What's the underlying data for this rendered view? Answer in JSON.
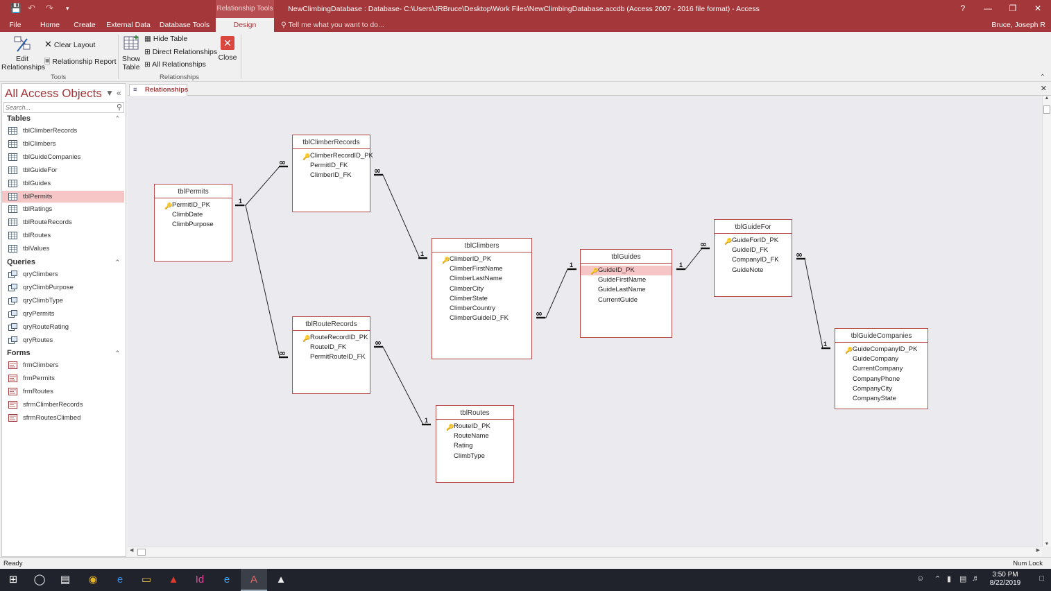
{
  "titlebar": {
    "title": "NewClimbingDatabase : Database- C:\\Users\\JRBruce\\Desktop\\Work Files\\NewClimbingDatabase.accdb (Access 2007 - 2016 file format) - Access",
    "context_tab": "Relationship Tools",
    "help": "?",
    "minimize": "—",
    "restore": "❐",
    "close": "✕"
  },
  "tabs": [
    {
      "label": "File"
    },
    {
      "label": "Home"
    },
    {
      "label": "Create"
    },
    {
      "label": "External Data"
    },
    {
      "label": "Database Tools"
    },
    {
      "label": "Design"
    }
  ],
  "tellme": "Tell me what you want to do...",
  "user": "Bruce, Joseph R",
  "ribbon": {
    "edit_relationships": "Edit Relationships",
    "clear_layout": "Clear Layout",
    "relationship_report": "Relationship Report",
    "show_table": "Show Table",
    "hide_table": "Hide Table",
    "direct_relationships": "Direct Relationships",
    "all_relationships": "All Relationships",
    "close": "Close",
    "group_tools": "Tools",
    "group_relationships": "Relationships"
  },
  "nav": {
    "title": "All Access Objects",
    "search_placeholder": "Search...",
    "sections": [
      {
        "label": "Tables"
      },
      {
        "label": "Queries"
      },
      {
        "label": "Forms"
      }
    ],
    "tables": [
      "tblClimberRecords",
      "tblClimbers",
      "tblGuideCompanies",
      "tblGuideFor",
      "tblGuides",
      "tblPermits",
      "tblRatings",
      "tblRouteRecords",
      "tblRoutes",
      "tblValues"
    ],
    "queries": [
      "qryClimbers",
      "qryClimbPurpose",
      "qryClimbType",
      "qryPermits",
      "qryRouteRating",
      "qryRoutes"
    ],
    "forms": [
      "frmClimbers",
      "frmPermits",
      "frmRoutes",
      "sfrmClimberRecords",
      "sfrmRoutesClimbed"
    ],
    "selected": "tblPermits"
  },
  "doc_tab": "Relationships",
  "tables": [
    {
      "name": "tblPermits",
      "fields": [
        {
          "name": "PermitID_PK",
          "key": true
        },
        {
          "name": "ClimbDate"
        },
        {
          "name": "ClimbPurpose"
        }
      ]
    },
    {
      "name": "tblClimberRecords",
      "fields": [
        {
          "name": "ClimberRecordID_PK",
          "key": true
        },
        {
          "name": "PermitID_FK"
        },
        {
          "name": "ClimberID_FK"
        }
      ]
    },
    {
      "name": "tblRouteRecords",
      "fields": [
        {
          "name": "RouteRecordID_PK",
          "key": true
        },
        {
          "name": "RouteID_FK"
        },
        {
          "name": "PermitRouteID_FK"
        }
      ]
    },
    {
      "name": "tblClimbers",
      "fields": [
        {
          "name": "ClimberID_PK",
          "key": true
        },
        {
          "name": "ClimberFirstName"
        },
        {
          "name": "ClimberLastName"
        },
        {
          "name": "ClimberCity"
        },
        {
          "name": "ClimberState"
        },
        {
          "name": "ClimberCountry"
        },
        {
          "name": "ClimberGuideID_FK"
        }
      ]
    },
    {
      "name": "tblRoutes",
      "fields": [
        {
          "name": "RouteID_PK",
          "key": true
        },
        {
          "name": "RouteName"
        },
        {
          "name": "Rating"
        },
        {
          "name": "ClimbType"
        }
      ]
    },
    {
      "name": "tblGuides",
      "fields": [
        {
          "name": "GuideID_PK",
          "key": true,
          "selected": true
        },
        {
          "name": "GuideFirstName"
        },
        {
          "name": "GuideLastName"
        },
        {
          "name": "CurrentGuide"
        }
      ]
    },
    {
      "name": "tblGuideFor",
      "fields": [
        {
          "name": "GuideForID_PK",
          "key": true
        },
        {
          "name": "GuideID_FK"
        },
        {
          "name": "CompanyID_FK"
        },
        {
          "name": "GuideNote"
        }
      ]
    },
    {
      "name": "tblGuideCompanies",
      "fields": [
        {
          "name": "GuideCompanyID_PK",
          "key": true
        },
        {
          "name": "GuideCompany"
        },
        {
          "name": "CurrentCompany"
        },
        {
          "name": "CompanyPhone"
        },
        {
          "name": "CompanyCity"
        },
        {
          "name": "CompanyState"
        }
      ]
    }
  ],
  "status": {
    "ready": "Ready",
    "numlock": "Num Lock"
  },
  "clock": {
    "time": "3:50 PM",
    "date": "8/22/2019"
  },
  "colors": {
    "accent": "#a4373a",
    "selection": "#f6c5c6"
  }
}
